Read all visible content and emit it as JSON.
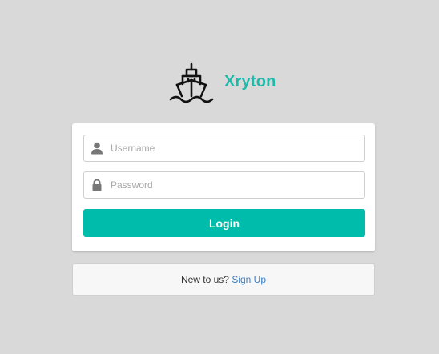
{
  "brand": {
    "name": "Xryton",
    "icon": "ship-icon",
    "accent_color": "#20b9aa"
  },
  "login_form": {
    "username": {
      "placeholder": "Username",
      "value": "",
      "icon": "user-icon"
    },
    "password": {
      "placeholder": "Password",
      "value": "",
      "icon": "lock-icon"
    },
    "login_label": "Login",
    "button_color": "#00bcaa"
  },
  "signup": {
    "prompt": "New to us?",
    "link_label": "Sign Up",
    "link_color": "#3a7ec6"
  }
}
